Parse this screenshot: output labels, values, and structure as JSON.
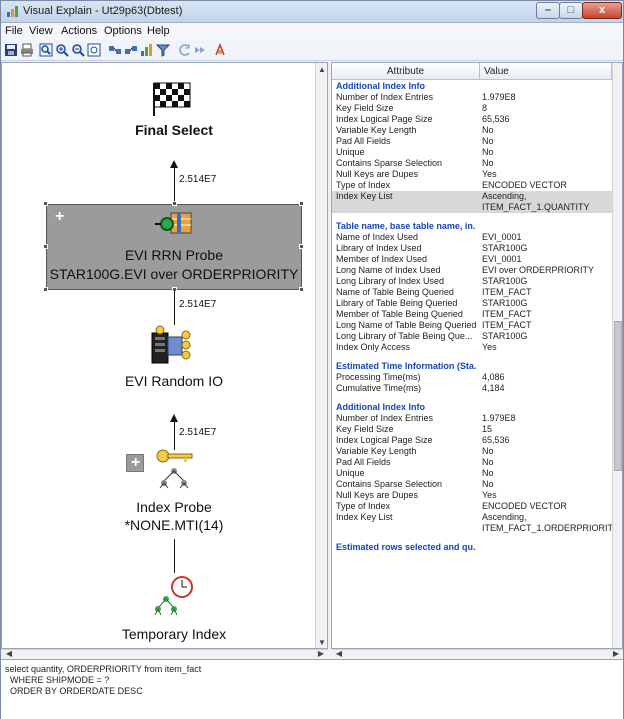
{
  "window": {
    "title": "Visual Explain - Ut29p63(Dbtest)",
    "controls": {
      "minimize": "–",
      "maximize": "□",
      "close": "x"
    }
  },
  "menu": [
    "File",
    "View",
    "Actions",
    "Options",
    "Help"
  ],
  "toolbar": {
    "icons": [
      "save-icon",
      "print-icon",
      "zoom-fit-icon",
      "zoom-in-icon",
      "zoom-out-icon",
      "zoom-reset-icon",
      "expand-icon",
      "collapse-icon",
      "statistics-icon",
      "filter-icon",
      "back-icon",
      "forward-icon",
      "refresh-icon"
    ]
  },
  "graph": {
    "nodes": [
      {
        "label": "Final Select"
      },
      {
        "label_line1": "EVI RRN Probe",
        "label_line2": "STAR100G.EVI over ORDERPRIORITY",
        "selected": true,
        "expand": "+"
      },
      {
        "label": "EVI Random IO"
      },
      {
        "label_line1": "Index Probe",
        "label_line2": "*NONE.MTI(14)",
        "expand": "+"
      },
      {
        "label": "Temporary Index"
      }
    ],
    "edges": [
      "2.514E7",
      "2.514E7",
      "2.514E7"
    ]
  },
  "attributes": {
    "col_attribute": "Attribute",
    "col_value": "Value",
    "rows": [
      {
        "a": "Additional Index Info",
        "v": "",
        "section": true
      },
      {
        "a": "Number of Index Entries",
        "v": "1.979E8"
      },
      {
        "a": "Key Field Size",
        "v": "8"
      },
      {
        "a": "Index Logical Page Size",
        "v": "65,536"
      },
      {
        "a": "Variable Key Length",
        "v": "No"
      },
      {
        "a": "Pad All Fields",
        "v": "No"
      },
      {
        "a": "Unique",
        "v": "No"
      },
      {
        "a": "Contains Sparse Selection",
        "v": "No"
      },
      {
        "a": "Null Keys are Dupes",
        "v": "Yes"
      },
      {
        "a": "Type of Index",
        "v": "ENCODED VECTOR"
      },
      {
        "a": "Index Key List",
        "v": "Ascending,",
        "v2": "ITEM_FACT_1.QUANTITY",
        "sel": true
      },
      {
        "a": "Table name, base table name, in...",
        "v": "",
        "section": true
      },
      {
        "a": "Name of Index Used",
        "v": "EVI_0001"
      },
      {
        "a": "Library of Index Used",
        "v": "STAR100G"
      },
      {
        "a": "Member of Index Used",
        "v": "EVI_0001"
      },
      {
        "a": "Long Name of Index Used",
        "v": "EVI over ORDERPRIORITY"
      },
      {
        "a": "Long Library of Index Used",
        "v": "STAR100G"
      },
      {
        "a": "Name of Table Being Queried",
        "v": "ITEM_FACT"
      },
      {
        "a": "Library of Table Being Queried",
        "v": "STAR100G"
      },
      {
        "a": "Member of Table Being Queried",
        "v": "ITEM_FACT"
      },
      {
        "a": "Long Name of Table Being Queried",
        "v": "ITEM_FACT"
      },
      {
        "a": "Long Library of Table Being Que...",
        "v": "STAR100G"
      },
      {
        "a": "Index Only Access",
        "v": "Yes"
      },
      {
        "a": "Estimated Time Information (Sta...",
        "v": "",
        "section": true
      },
      {
        "a": "Processing Time(ms)",
        "v": "4,086"
      },
      {
        "a": "Cumulative Time(ms)",
        "v": "4,184"
      },
      {
        "a": "Additional Index Info",
        "v": "",
        "section": true
      },
      {
        "a": "Number of Index Entries",
        "v": "1.979E8"
      },
      {
        "a": "Key Field Size",
        "v": "15"
      },
      {
        "a": "Index Logical Page Size",
        "v": "65,536"
      },
      {
        "a": "Variable Key Length",
        "v": "No"
      },
      {
        "a": "Pad All Fields",
        "v": "No"
      },
      {
        "a": "Unique",
        "v": "No"
      },
      {
        "a": "Contains Sparse Selection",
        "v": "No"
      },
      {
        "a": "Null Keys are Dupes",
        "v": "Yes"
      },
      {
        "a": "Type of Index",
        "v": "ENCODED VECTOR"
      },
      {
        "a": "Index Key List",
        "v": "Ascending,",
        "v2": "ITEM_FACT_1.ORDERPRIORITY"
      },
      {
        "a": "Estimated rows selected and qu...",
        "v": "",
        "section": true
      }
    ]
  },
  "sql": {
    "lines": [
      "select quantity, ORDERPRIORITY from item_fact",
      "  WHERE SHIPMODE = ?",
      "  ORDER BY ORDERDATE DESC"
    ]
  }
}
